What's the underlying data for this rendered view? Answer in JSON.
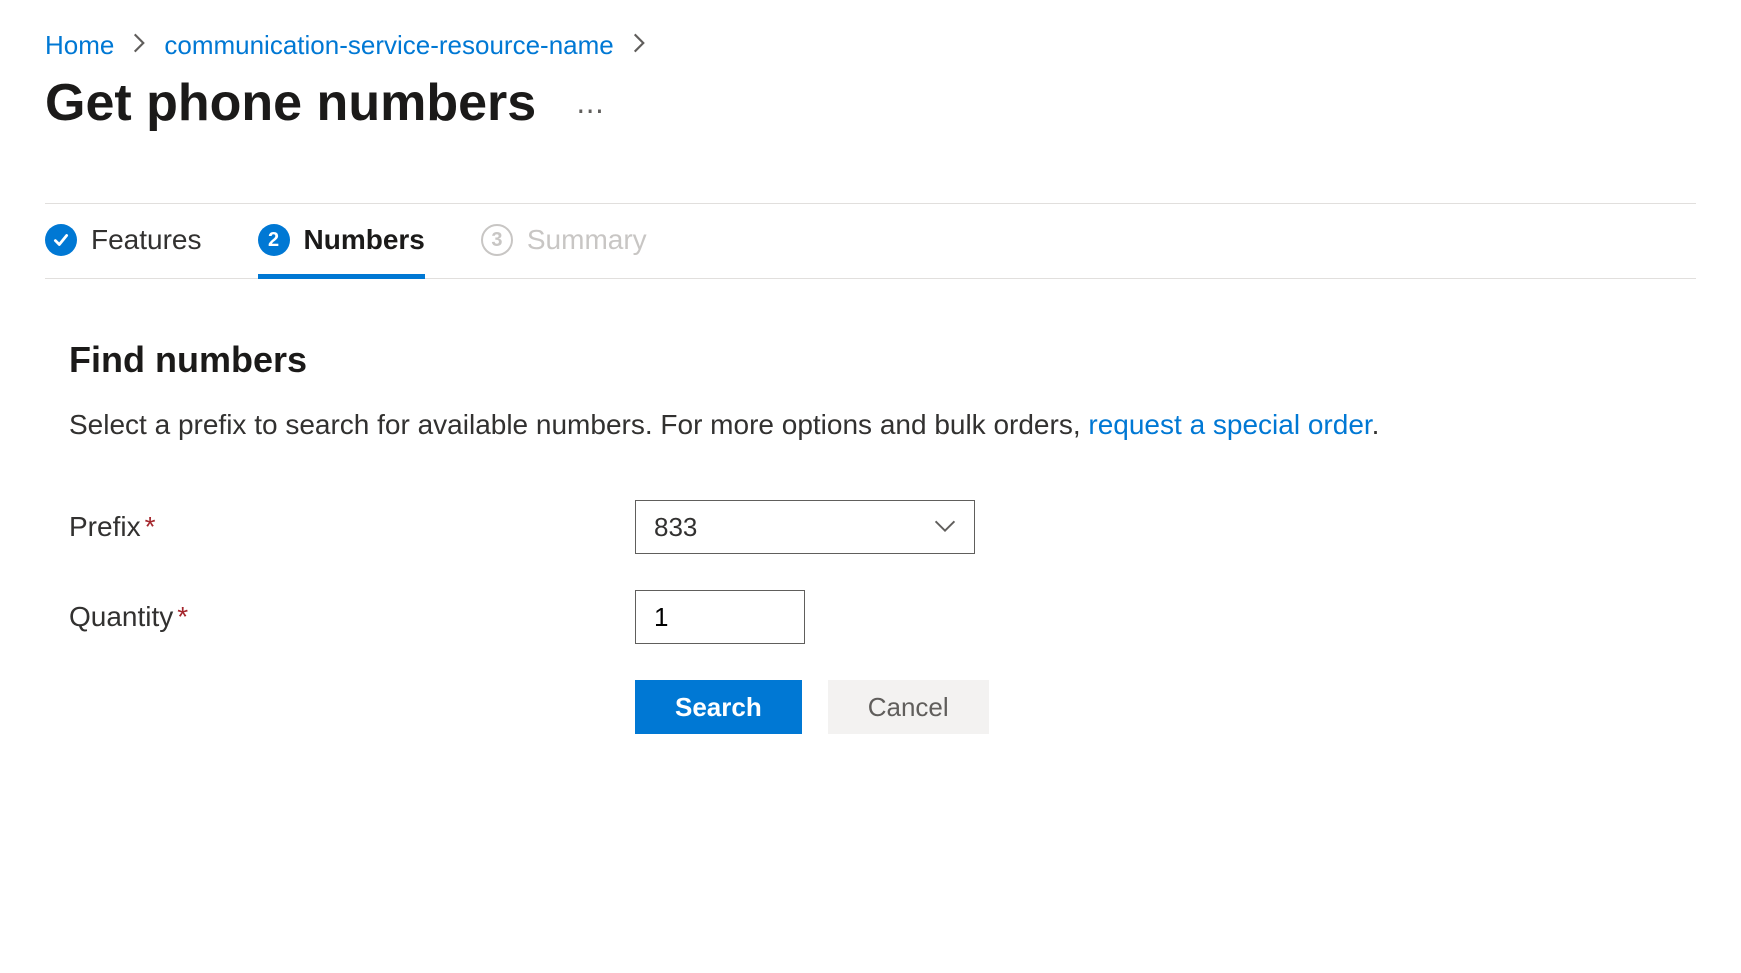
{
  "breadcrumb": {
    "items": [
      {
        "label": "Home"
      },
      {
        "label": "communication-service-resource-name"
      }
    ]
  },
  "page": {
    "title": "Get phone numbers"
  },
  "tabs": [
    {
      "label": "Features",
      "state": "completed"
    },
    {
      "label": "Numbers",
      "state": "active",
      "number": "2"
    },
    {
      "label": "Summary",
      "state": "disabled",
      "number": "3"
    }
  ],
  "section": {
    "title": "Find numbers",
    "description_prefix": "Select a prefix to search for available numbers. For more options and bulk orders, ",
    "link_text": "request a special order",
    "suffix": "."
  },
  "form": {
    "prefix": {
      "label": "Prefix",
      "value": "833"
    },
    "quantity": {
      "label": "Quantity",
      "value": "1"
    }
  },
  "buttons": {
    "search": "Search",
    "cancel": "Cancel"
  }
}
